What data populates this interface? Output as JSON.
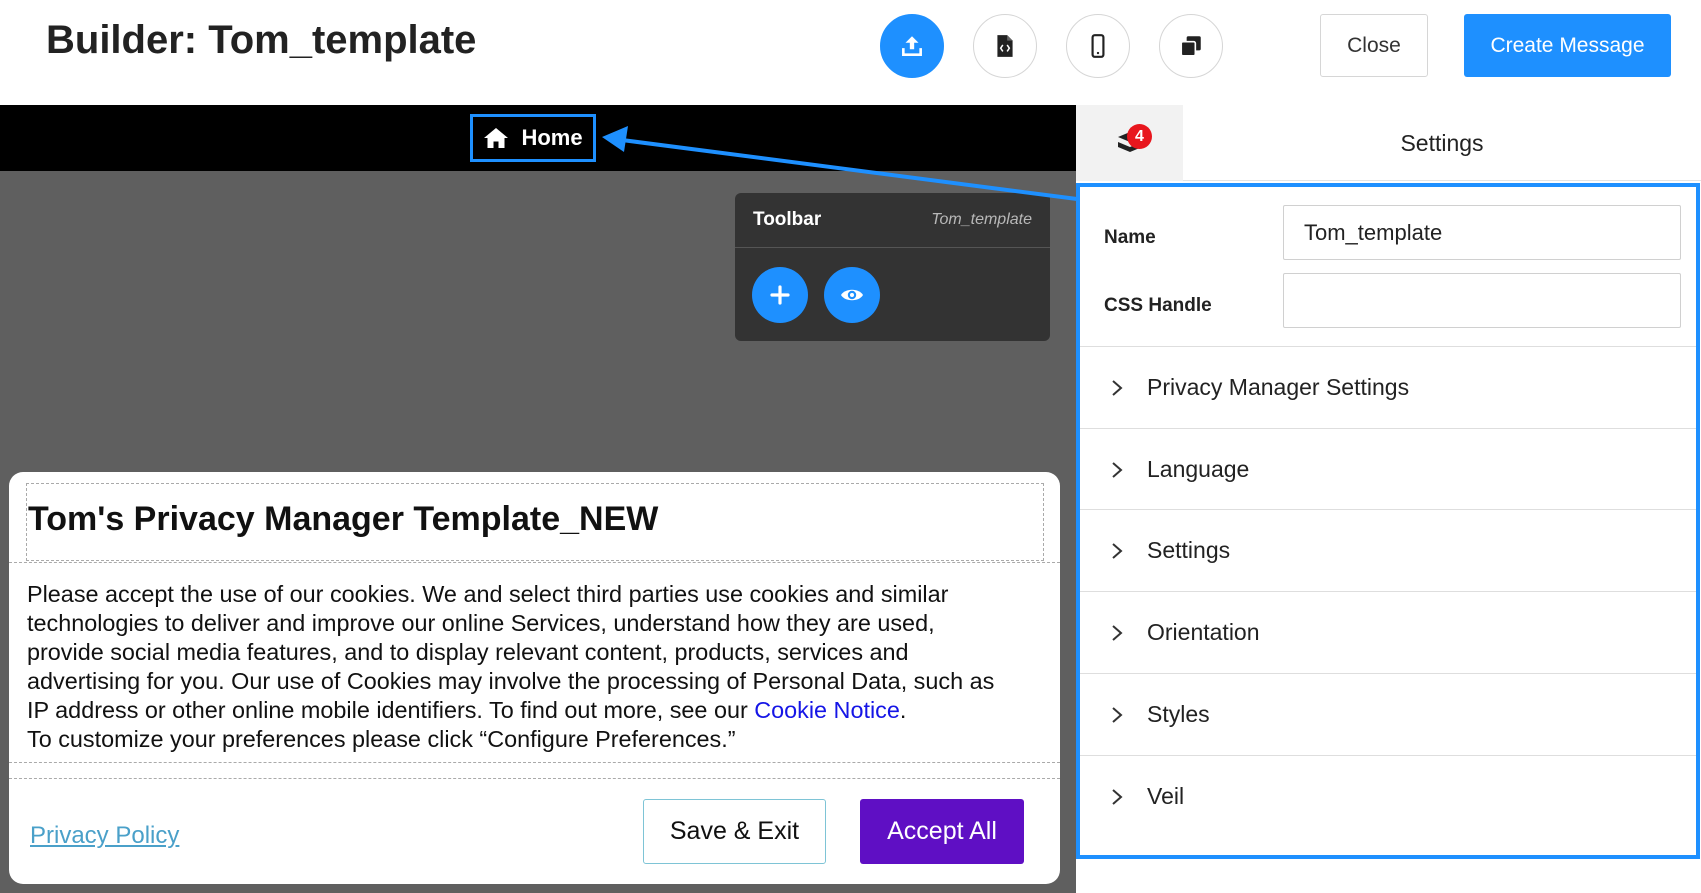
{
  "header": {
    "title": "Builder: Tom_template",
    "icons": [
      "publish-icon",
      "code-file-icon",
      "mobile-device-icon",
      "duplicate-icon"
    ],
    "close_label": "Close",
    "create_label": "Create Message"
  },
  "canvas": {
    "breadcrumb": {
      "icon": "home-icon",
      "label": "Home"
    },
    "toolbar": {
      "title": "Toolbar",
      "subtitle": "Tom_template",
      "buttons": [
        "plus-icon",
        "eye-icon"
      ]
    }
  },
  "modal": {
    "title": "Tom's Privacy Manager Template_NEW",
    "body_line1": "Please accept the use of our cookies. We and select third parties use cookies and similar",
    "body_line2": "technologies to deliver and improve our online Services, understand how they are used,",
    "body_line3": "provide social media features, and to display relevant content, products, services and",
    "body_line4": "advertising for you. Our use of Cookies may involve the processing of Personal Data, such as",
    "body_line5_prefix": "IP address or other online mobile identifiers. To find out more, see our ",
    "cookie_notice_link": "Cookie Notice",
    "body_line5_suffix": ".",
    "body_line6": "To customize your preferences please click “Configure Preferences.”",
    "privacy_policy_label": "Privacy Policy",
    "save_exit_label": "Save & Exit",
    "accept_all_label": "Accept All",
    "accent_color": "#5f0fc4"
  },
  "panel": {
    "tab_badge_count": "4",
    "tab_label": "Settings",
    "fields": {
      "name_label": "Name",
      "name_value": "Tom_template",
      "css_label": "CSS Handle",
      "css_value": ""
    },
    "sections": [
      {
        "label": "Privacy Manager Settings"
      },
      {
        "label": "Language"
      },
      {
        "label": "Settings"
      },
      {
        "label": "Orientation"
      },
      {
        "label": "Styles"
      },
      {
        "label": "Veil"
      }
    ]
  },
  "colors": {
    "primary": "#1e90ff",
    "canvas_bg": "#5f5f5f",
    "toolbar_bg": "#333333",
    "badge": "#e8161d"
  }
}
